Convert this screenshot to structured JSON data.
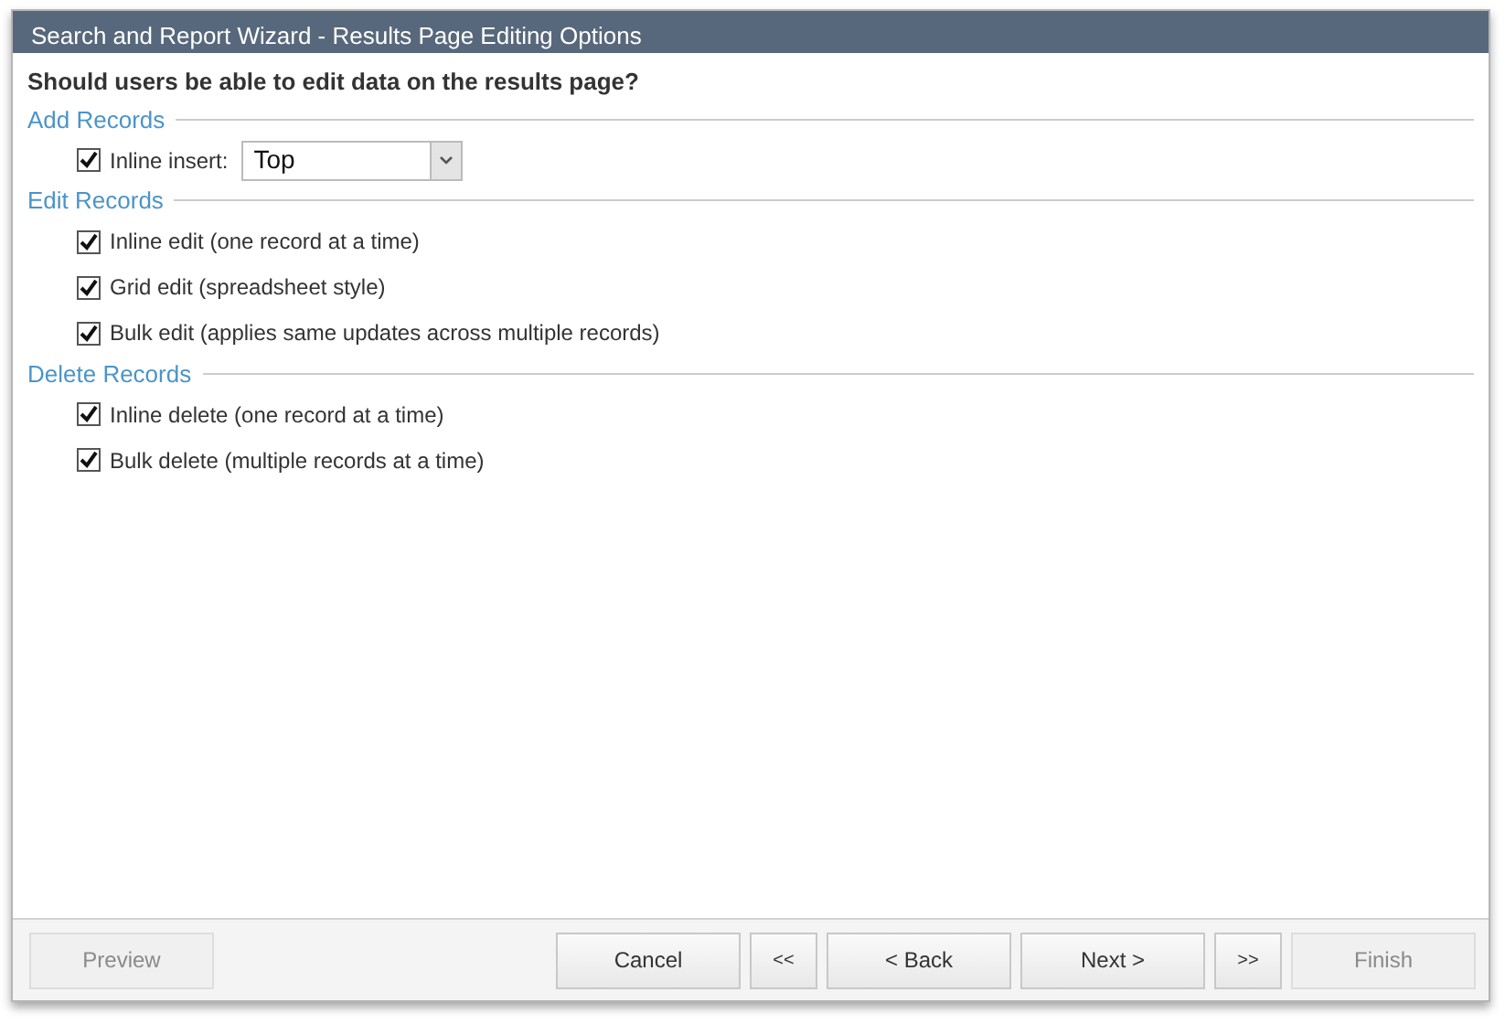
{
  "window": {
    "title": "Search and Report Wizard - Results Page Editing Options"
  },
  "question": "Should users be able to edit data on the results page?",
  "sections": [
    {
      "title": "Add Records",
      "options": [
        {
          "kind": "select",
          "label": "Inline insert:",
          "checked": true,
          "value": "Top"
        }
      ]
    },
    {
      "title": "Edit Records",
      "options": [
        {
          "kind": "checkbox",
          "label": "Inline edit (one record at a time)",
          "checked": true
        },
        {
          "kind": "checkbox",
          "label": "Grid edit (spreadsheet style)",
          "checked": true
        },
        {
          "kind": "checkbox",
          "label": "Bulk edit (applies same updates across multiple records)",
          "checked": true
        }
      ]
    },
    {
      "title": "Delete Records",
      "options": [
        {
          "kind": "checkbox",
          "label": "Inline delete (one record at a time)",
          "checked": true
        },
        {
          "kind": "checkbox",
          "label": "Bulk delete (multiple records at a time)",
          "checked": true
        }
      ]
    }
  ],
  "left_buttons": [
    {
      "label": "Preview",
      "disabled": true
    }
  ],
  "buttons": [
    {
      "label": "Cancel",
      "disabled": false,
      "kind": "wide"
    },
    {
      "label": "<<",
      "disabled": false,
      "kind": "small"
    },
    {
      "label": "< Back",
      "disabled": false,
      "kind": "wide"
    },
    {
      "label": "Next >",
      "disabled": false,
      "kind": "wide"
    },
    {
      "label": ">>",
      "disabled": false,
      "kind": "small"
    },
    {
      "label": "Finish",
      "disabled": true,
      "kind": "wide"
    }
  ]
}
